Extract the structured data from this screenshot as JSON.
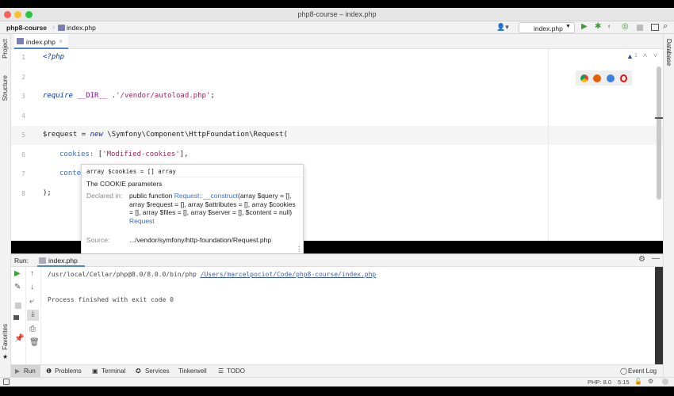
{
  "window": {
    "title": "php8-course – index.php"
  },
  "breadcrumb": {
    "project": "php8-course",
    "file": "index.php"
  },
  "toolbar": {
    "run_config": "index.php"
  },
  "editor_tab": {
    "label": "index.php"
  },
  "side_tabs": {
    "project": "Project",
    "structure": "Structure",
    "favorites": "Favorites",
    "database": "Database"
  },
  "inspection": {
    "warnings": "1"
  },
  "code": {
    "line_numbers": [
      "1",
      "2",
      "3",
      "4",
      "5",
      "6",
      "7",
      "8"
    ],
    "l1": "<?php",
    "l3_kw": "require",
    "l3_const": " __DIR__ .",
    "l3_str": "'/vendor/autoload.php'",
    "l3_end": ";",
    "l5_var": "$request",
    "l5_eq": " = ",
    "l5_kw": "new",
    "l5_class": " \\Symfony\\Component\\HttpFoundation\\Request(",
    "l6_param": "cookies:",
    "l6_str": "'Modified-cookies'",
    "l6_open": " [",
    "l6_end": "],",
    "l7_param": "conte",
    "l8": ");"
  },
  "tooltip": {
    "signature": "array $cookies = [] array",
    "description": "The COOKIE parameters",
    "declared_label": "Declared in:",
    "declared_prefix": "public function ",
    "declared_link": "Request::__construct",
    "declared_rest": "(array $query = [], array $request = [], array $attributes = [], array $cookies = [], array $files = [], array $server = [], $content = null)",
    "class_link": "Request",
    "source_label": "Source:",
    "source_value": ".../vendor/symfony/http-foundation/Request.php"
  },
  "run": {
    "label": "Run:",
    "tab": "index.php",
    "cmd": "/usr/local/Cellar/php@8.0/8.0.0/bin/php ",
    "cmd_link": "/Users/marcelpociot/Code/php8-course/index.php",
    "result": "Process finished with exit code 0"
  },
  "bottom_tabs": [
    "Run",
    "Problems",
    "Terminal",
    "Services",
    "Tinkerwell",
    "TODO"
  ],
  "event_log": "Event Log",
  "status": {
    "php": "PHP: 8.0",
    "position": "5:15"
  },
  "colors": {
    "run_green": "#3f9c35",
    "link": "#3b6dbf",
    "accent": "#4a86c8"
  }
}
